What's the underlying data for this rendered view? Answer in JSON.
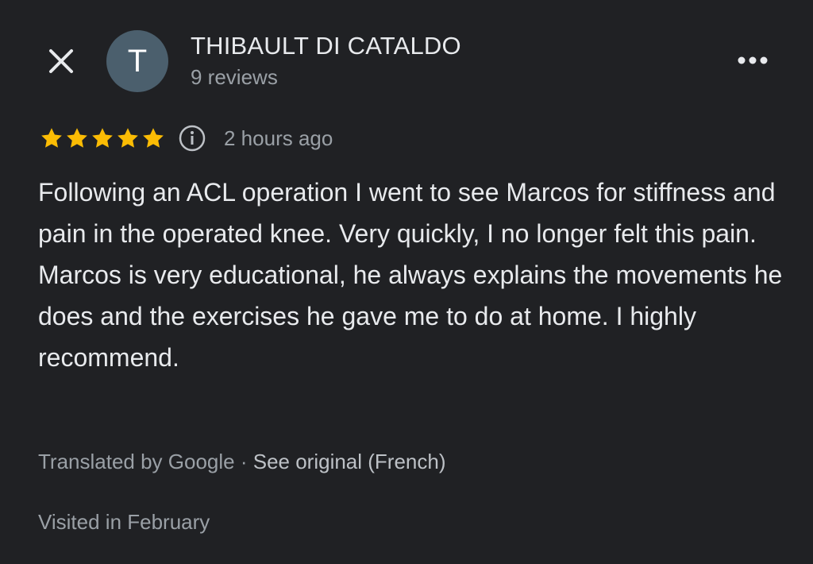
{
  "colors": {
    "background": "#202124",
    "star": "#fbbc04",
    "avatar_bg": "#4b5f6d",
    "primary_text": "#e8eaed",
    "secondary_text": "#9aa0a6"
  },
  "icons": {
    "close": "close-icon",
    "more": "more-dots-icon",
    "info": "info-icon",
    "star": "star-icon"
  },
  "author": {
    "initial": "T",
    "name": "THIBAULT DI CATALDO",
    "reviews": "9 reviews"
  },
  "review": {
    "rating": 5,
    "rating_max": 5,
    "time_ago": "2 hours ago",
    "text": "Following an ACL operation I went to see Marcos for stiffness and pain in the operated knee. Very quickly, I no longer felt this pain. Marcos is very educational, he always explains the movements he does and the exercises he gave me to do at home. I highly recommend.",
    "translated_by": "Translated by Google",
    "separator": " · ",
    "see_original": "See original (French)",
    "visited": "Visited in February"
  }
}
